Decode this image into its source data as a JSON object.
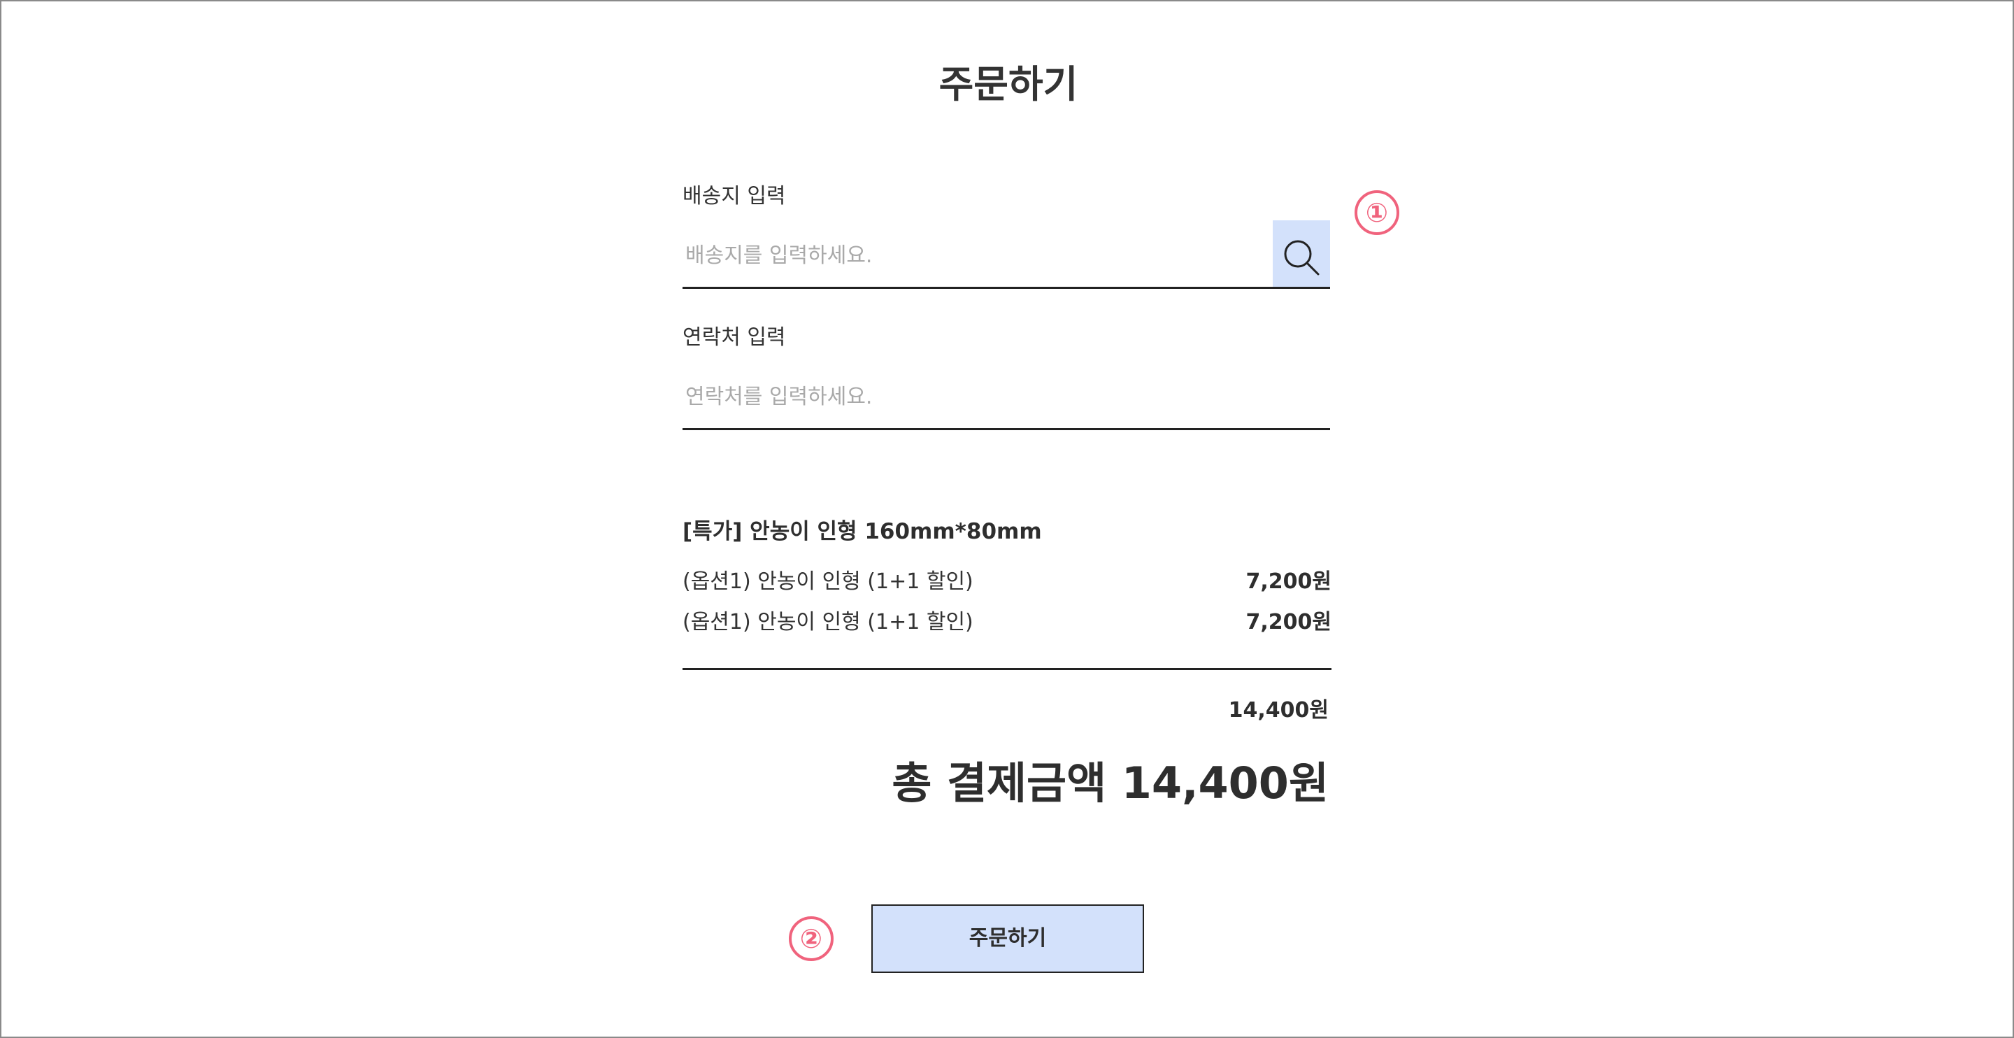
{
  "page": {
    "title": "주문하기"
  },
  "address": {
    "label": "배송지 입력",
    "placeholder": "배송지를 입력하세요.",
    "value": ""
  },
  "contact": {
    "label": "연락처 입력",
    "placeholder": "연락처를 입력하세요.",
    "value": ""
  },
  "annotations": {
    "marker_1": "①",
    "marker_2": "②"
  },
  "order": {
    "product_name": "[특가] 안농이 인형 160mm*80mm",
    "options": [
      {
        "name": "(옵션1) 안농이 인형 (1+1 할인)",
        "price": "7,200원"
      },
      {
        "name": "(옵션1) 안농이 인형 (1+1 할인)",
        "price": "7,200원"
      }
    ],
    "subtotal": "14,400원",
    "total_text": "총 결제금액 14,400원",
    "submit_label": "주문하기"
  },
  "colors": {
    "accent_fill": "#d3e1fb",
    "marker": "#f0637d",
    "text": "#333333",
    "placeholder": "#a9a9a9"
  },
  "icons": {
    "search": "search-icon"
  }
}
